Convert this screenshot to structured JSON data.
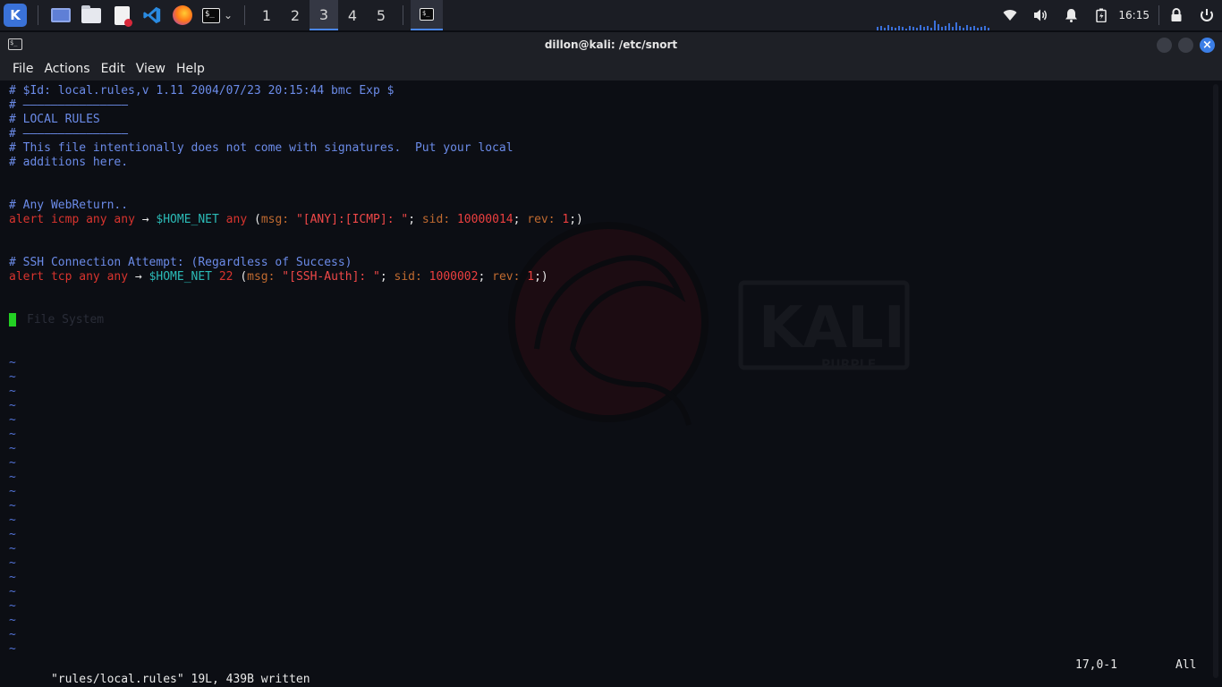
{
  "taskbar": {
    "workspaces": [
      "1",
      "2",
      "3",
      "4",
      "5"
    ],
    "active_workspace": "3",
    "clock": "16:15",
    "icons": [
      "kali-menu-icon",
      "desktop-icon",
      "file-manager-icon",
      "text-editor-icon",
      "vscode-icon",
      "firefox-icon",
      "terminal-icon",
      "chevron-down-icon",
      "network-icon",
      "volume-icon",
      "bell-icon",
      "battery-icon",
      "lock-icon",
      "power-icon"
    ]
  },
  "window": {
    "title": "dillon@kali: /etc/snort",
    "menu": [
      "File",
      "Actions",
      "Edit",
      "View",
      "Help"
    ]
  },
  "editor": {
    "header_comment": "# $Id: local.rules,v 1.11 2004/07/23 20:15:44 bmc Exp $",
    "rule_line": "# ———————————————",
    "local_rules_comment": "# LOCAL RULES",
    "intro_comment_1": "# This file intentionally does not come with signatures.  Put your local",
    "intro_comment_2": "# additions here.",
    "rule1": {
      "comment": "# Any WebReturn..",
      "action": "alert",
      "proto": "icmp",
      "src": "any any",
      "arrow": "→",
      "dst_var": "$HOME_NET",
      "dst_port": "any",
      "msg_key": "msg:",
      "msg": "\"[ANY]:[ICMP]: \"",
      "sid_key": "sid:",
      "sid": "10000014",
      "rev_key": "rev:",
      "rev": "1"
    },
    "rule2": {
      "comment": "# SSH Connection Attempt: (Regardless of Success)",
      "action": "alert",
      "proto": "tcp",
      "src": "any any",
      "arrow": "→",
      "dst_var": "$HOME_NET",
      "dst_port": "22",
      "msg_key": "msg:",
      "msg": "\"[SSH-Auth]: \"",
      "sid_key": "sid:",
      "sid": "1000002",
      "rev_key": "rev:",
      "rev": "1"
    },
    "ghost_text": "File System",
    "tilde": "~",
    "status_message": "\"rules/local.rules\" 19L, 439B written",
    "cursor_position": "17,0-1",
    "scroll_position": "All"
  }
}
